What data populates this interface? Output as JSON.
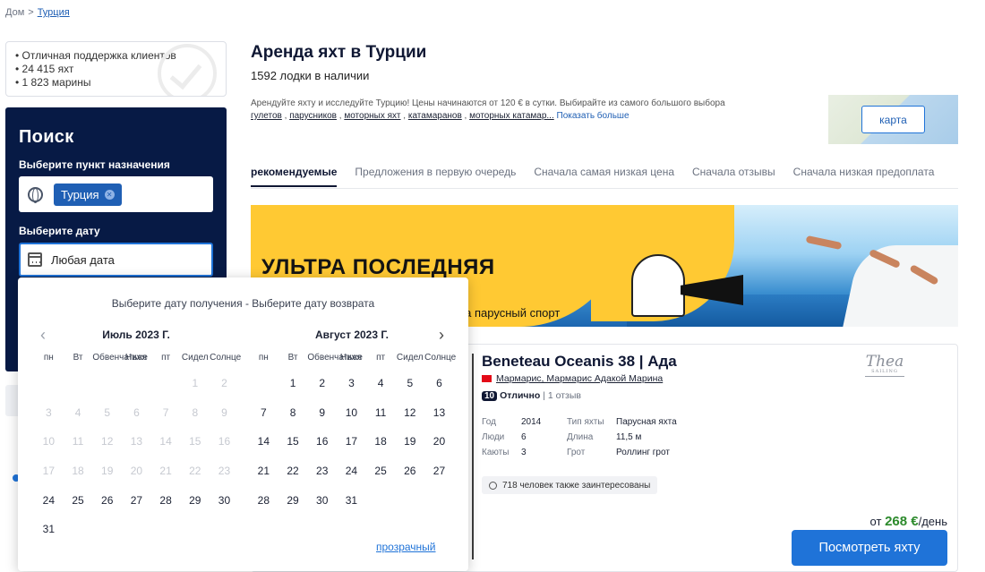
{
  "breadcrumb": {
    "home": "Дом",
    "sep": ">",
    "current": "Турция"
  },
  "features": [
    "• Отличная поддержка клиентов",
    "• 24 415 яхт",
    "• 1 823 марины"
  ],
  "search": {
    "title": "Поиск",
    "dest_label": "Выберите пункт назначения",
    "dest_chip": "Турция",
    "date_label": "Выберите дату",
    "date_value": "Любая дата"
  },
  "page": {
    "title": "Аренда яхт в Турции",
    "count": "1592 лодки в наличии",
    "desc_intro": "Арендуйте яхту и исследуйте Турцию! Цены начинаются от 120 € в сутки. Выбирайте из самого большого выбора",
    "desc_links": [
      "гулетов",
      "парусников",
      "моторных яхт",
      "катамаранов",
      "моторных катамар..."
    ],
    "show_more": "Показать больше",
    "map_button": "карта"
  },
  "tabs": [
    "рекомендуемые",
    "Предложения в первую очередь",
    "Сначала самая низкая цена",
    "Сначала отзывы",
    "Сначала низкая предоплата"
  ],
  "banner": {
    "title": "УЛЬТРА ПОСЛЕДНЯЯ",
    "subtitle": "на парусный спорт"
  },
  "listing": {
    "name": "Beneteau Oceanis 38 | Ада",
    "location": "Мармарис, Мармарис Адакой Марина",
    "score": "10",
    "quality": "Отлично",
    "reviews": "| 1 отзыв",
    "specs": [
      {
        "k": "Год",
        "v": "2014",
        "k2": "Тип яхты",
        "v2": "Парусная яхта"
      },
      {
        "k": "Люди",
        "v": "6",
        "k2": "Длина",
        "v2": "11,5 м"
      },
      {
        "k": "Каюты",
        "v": "3",
        "k2": "Грот",
        "v2": "Роллинг грот"
      }
    ],
    "interest": "718 человек также заинтересованы",
    "logo": "Thea",
    "logo_sub": "SAILING",
    "price_prefix": "от",
    "price": "268 €",
    "price_suffix": "/день",
    "button": "Посмотреть яхту"
  },
  "picker": {
    "header": "Выберите дату получения - Выберите дату возврата",
    "prev_icon": "‹",
    "next_icon": "›",
    "clear": "прозрачный",
    "months": [
      {
        "name": "Июль 2023 Г.",
        "weekdays": [
          "пн",
          "Вт",
          "Обвенчаться",
          "Ниже",
          "пт",
          "Сидел",
          "Солнце"
        ],
        "days": [
          [
            "",
            "",
            "",
            "",
            "",
            "1",
            "2"
          ],
          [
            "3",
            "4",
            "5",
            "6",
            "7",
            "8",
            "9"
          ],
          [
            "10",
            "11",
            "12",
            "13",
            "14",
            "15",
            "16"
          ],
          [
            "17",
            "18",
            "19",
            "20",
            "21",
            "22",
            "23"
          ],
          [
            "24",
            "25",
            "26",
            "27",
            "28",
            "29",
            "30"
          ],
          [
            "31",
            "",
            "",
            "",
            "",
            "",
            ""
          ]
        ],
        "enabled_from": 24
      },
      {
        "name": "Август 2023 Г.",
        "weekdays": [
          "пн",
          "Вт",
          "Обвенчаться",
          "Ниже",
          "пт",
          "Сидел",
          "Солнце"
        ],
        "days": [
          [
            "",
            "1",
            "2",
            "3",
            "4",
            "5",
            "6"
          ],
          [
            "7",
            "8",
            "9",
            "10",
            "11",
            "12",
            "13"
          ],
          [
            "14",
            "15",
            "16",
            "17",
            "18",
            "19",
            "20"
          ],
          [
            "21",
            "22",
            "23",
            "24",
            "25",
            "26",
            "27"
          ],
          [
            "28",
            "29",
            "30",
            "31",
            "",
            "",
            ""
          ]
        ],
        "enabled_from": 1
      }
    ]
  }
}
